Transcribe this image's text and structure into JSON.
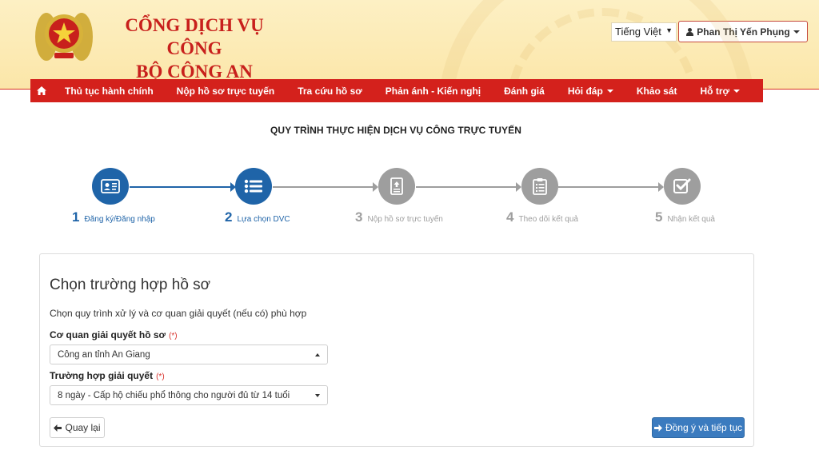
{
  "header": {
    "title_line1": "CỔNG DỊCH VỤ CÔNG",
    "title_line2": "BỘ CÔNG AN",
    "language": "Tiếng Việt",
    "user_name": "Phan Thị Yến Phụng"
  },
  "nav": {
    "items": [
      {
        "label": "Thủ tục hành chính",
        "dropdown": false
      },
      {
        "label": "Nộp hồ sơ trực tuyến",
        "dropdown": false
      },
      {
        "label": "Tra cứu hồ sơ",
        "dropdown": false
      },
      {
        "label": "Phản ánh - Kiến nghị",
        "dropdown": false
      },
      {
        "label": "Đánh giá",
        "dropdown": false
      },
      {
        "label": "Hỏi đáp",
        "dropdown": true
      },
      {
        "label": "Khảo sát",
        "dropdown": false
      },
      {
        "label": "Hỗ trợ",
        "dropdown": true
      }
    ]
  },
  "process": {
    "title": "QUY TRÌNH THỰC HIỆN DỊCH VỤ CÔNG TRỰC TUYẾN",
    "steps": [
      {
        "number": "1",
        "label": "Đăng ký/Đăng nhập",
        "state": "done",
        "icon": "id-card-icon"
      },
      {
        "number": "2",
        "label": "Lựa chọn DVC",
        "state": "current",
        "icon": "list-icon"
      },
      {
        "number": "3",
        "label": "Nộp hồ sơ trực tuyến",
        "state": "pending",
        "icon": "document-upload-icon"
      },
      {
        "number": "4",
        "label": "Theo dõi kết quả",
        "state": "pending",
        "icon": "clipboard-icon"
      },
      {
        "number": "5",
        "label": "Nhận kết quả",
        "state": "pending",
        "icon": "check-square-icon"
      }
    ]
  },
  "form": {
    "heading": "Chọn trường hợp hồ sơ",
    "description": "Chọn quy trình xử lý và cơ quan giải quyết (nếu có) phù hợp",
    "agency_label": "Cơ quan giải quyết hồ sơ",
    "agency_value": "Công an tỉnh An Giang",
    "case_label": "Trường hợp giải quyết",
    "case_value": "8 ngày - Cấp hộ chiếu phổ thông cho người đủ từ 14 tuổi",
    "required_mark": "(*)",
    "back_label": "Quay lại",
    "next_label": "Đồng ý và tiếp tục"
  },
  "colors": {
    "brand_red": "#d4211c",
    "active_blue": "#1f64a8",
    "inactive_gray": "#9e9e9e",
    "primary_button": "#3b7bbf"
  }
}
